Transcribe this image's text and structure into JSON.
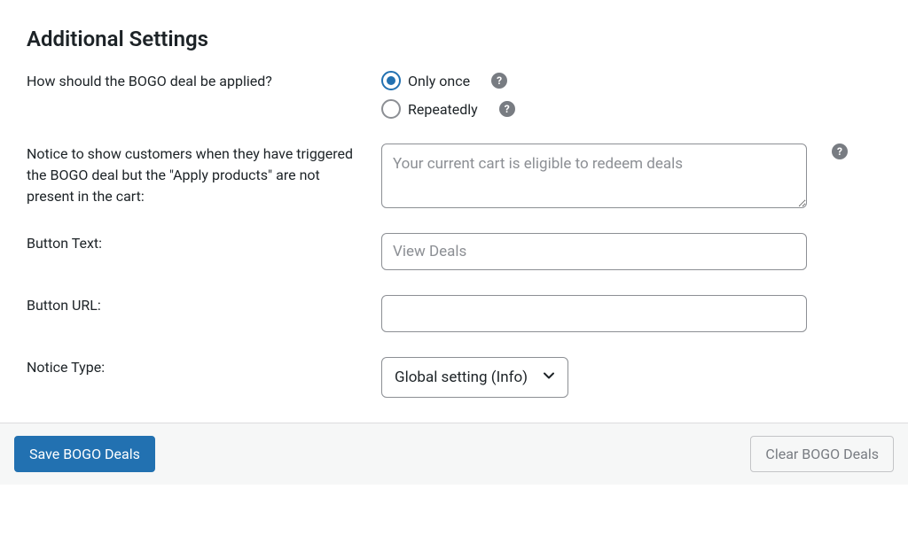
{
  "section_title": "Additional Settings",
  "apply_mode": {
    "label": "How should the BOGO deal be applied?",
    "options": {
      "once": "Only once",
      "repeatedly": "Repeatedly"
    },
    "selected": "once"
  },
  "notice_message": {
    "label": "Notice to show customers when they have triggered the BOGO deal but the \"Apply products\" are not present in the cart:",
    "placeholder": "Your current cart is eligible to redeem deals",
    "value": ""
  },
  "button_text": {
    "label": "Button Text:",
    "placeholder": "View Deals",
    "value": ""
  },
  "button_url": {
    "label": "Button URL:",
    "placeholder": "",
    "value": ""
  },
  "notice_type": {
    "label": "Notice Type:",
    "selected": "Global setting (Info)"
  },
  "footer": {
    "save_label": "Save BOGO Deals",
    "clear_label": "Clear BOGO Deals"
  },
  "help_glyph": "?"
}
